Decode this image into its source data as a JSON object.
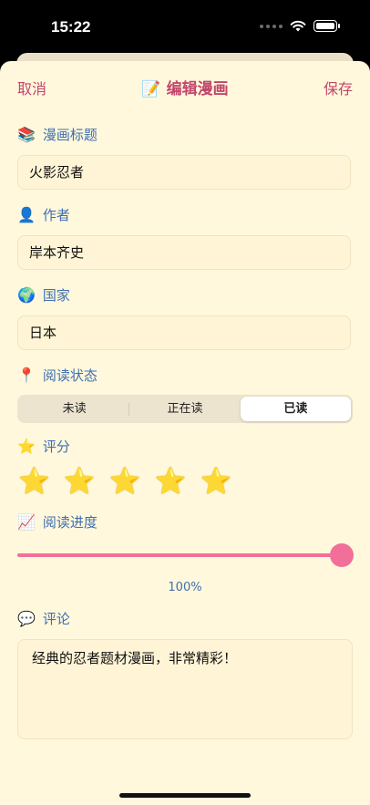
{
  "status_bar": {
    "time": "15:22"
  },
  "nav": {
    "cancel": "取消",
    "title_emoji": "📝",
    "title": "编辑漫画",
    "save": "保存"
  },
  "fields": {
    "title": {
      "emoji": "📚",
      "label": "漫画标题",
      "value": "火影忍者"
    },
    "author": {
      "emoji": "👤",
      "label": "作者",
      "value": "岸本齐史"
    },
    "country": {
      "emoji": "🌍",
      "label": "国家",
      "value": "日本"
    }
  },
  "reading_status": {
    "emoji": "📍",
    "label": "阅读状态",
    "options": [
      "未读",
      "正在读",
      "已读"
    ],
    "selected": "已读"
  },
  "rating": {
    "emoji": "⭐",
    "label": "评分",
    "stars": 5,
    "max": 5,
    "star_glyph": "⭐"
  },
  "progress": {
    "emoji": "📈",
    "label": "阅读进度",
    "value": 1.0,
    "value_text": "100%"
  },
  "comment": {
    "emoji": "💬",
    "label": "评论",
    "value": "经典的忍者题材漫画，非常精彩！"
  },
  "colors": {
    "accent": "#c2466b",
    "label": "#3f6fb0",
    "slider": "#f17099",
    "background": "#fff8dc"
  }
}
